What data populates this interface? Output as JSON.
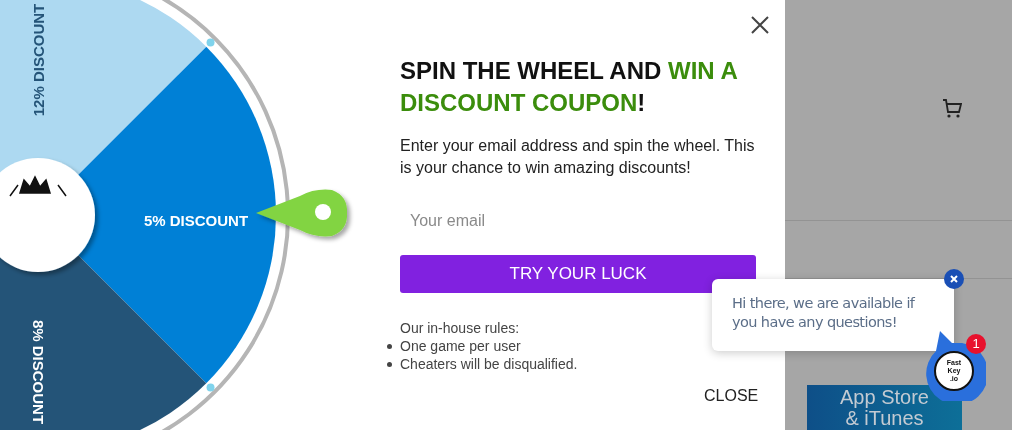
{
  "wheel": {
    "segments": [
      {
        "label": "12% DISCOUNT",
        "color": "#add9f1"
      },
      {
        "label": "5% DISCOUNT",
        "color": "#0080d6"
      },
      {
        "label": "8% DISCOUNT",
        "color": "#245478"
      }
    ]
  },
  "popup": {
    "title": "SPIN THE WHEEL AND ",
    "title_highlight": "WIN A DISCOUNT COUPON",
    "title_end": "!",
    "description": "Enter your email address and spin the wheel. This is your chance to win amazing discounts!",
    "email": {
      "placeholder": "Your email"
    },
    "submit_button": "TRY YOUR LUCK",
    "rules_heading": "Our in-house rules:",
    "rules": [
      "One game per user",
      "Cheaters will be disqualified."
    ],
    "close_link": "CLOSE"
  },
  "background_page": {
    "tile": [
      "App Store",
      "& iTunes"
    ]
  },
  "chat": {
    "message": "Hi there, we are available if you have any questions!",
    "badge": "1",
    "avatar_text": [
      "Fast",
      "Key",
      ".io"
    ]
  }
}
